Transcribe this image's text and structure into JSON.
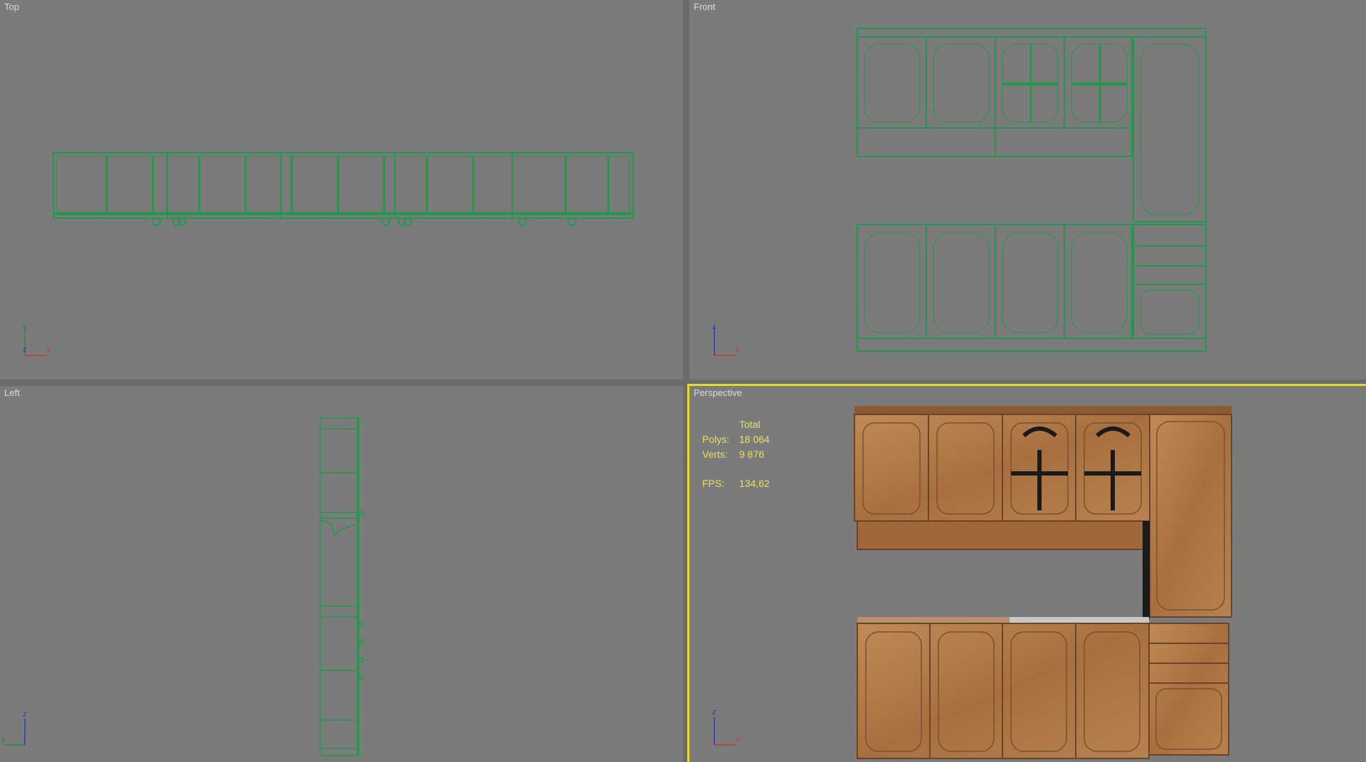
{
  "viewports": {
    "top": {
      "label": "Top",
      "axes": [
        "y",
        "z",
        "x"
      ]
    },
    "front": {
      "label": "Front",
      "axes": [
        "z",
        "x"
      ]
    },
    "left": {
      "label": "Left",
      "axes": [
        "z",
        "y"
      ]
    },
    "perspective": {
      "label": "Perspective",
      "axes": [
        "z",
        "x"
      ],
      "stats": {
        "header": "Total",
        "polys_label": "Polys:",
        "polys_value": "18 064",
        "verts_label": "Verts:",
        "verts_value": "9 876",
        "fps_label": "FPS:",
        "fps_value": "134,62"
      }
    }
  },
  "colors": {
    "viewport_bg": "#7b7b7b",
    "wireframe": "#1f9a4a",
    "active_border": "#e9d830",
    "wood": "#b07a4c",
    "stats_text": "#e8e060"
  }
}
